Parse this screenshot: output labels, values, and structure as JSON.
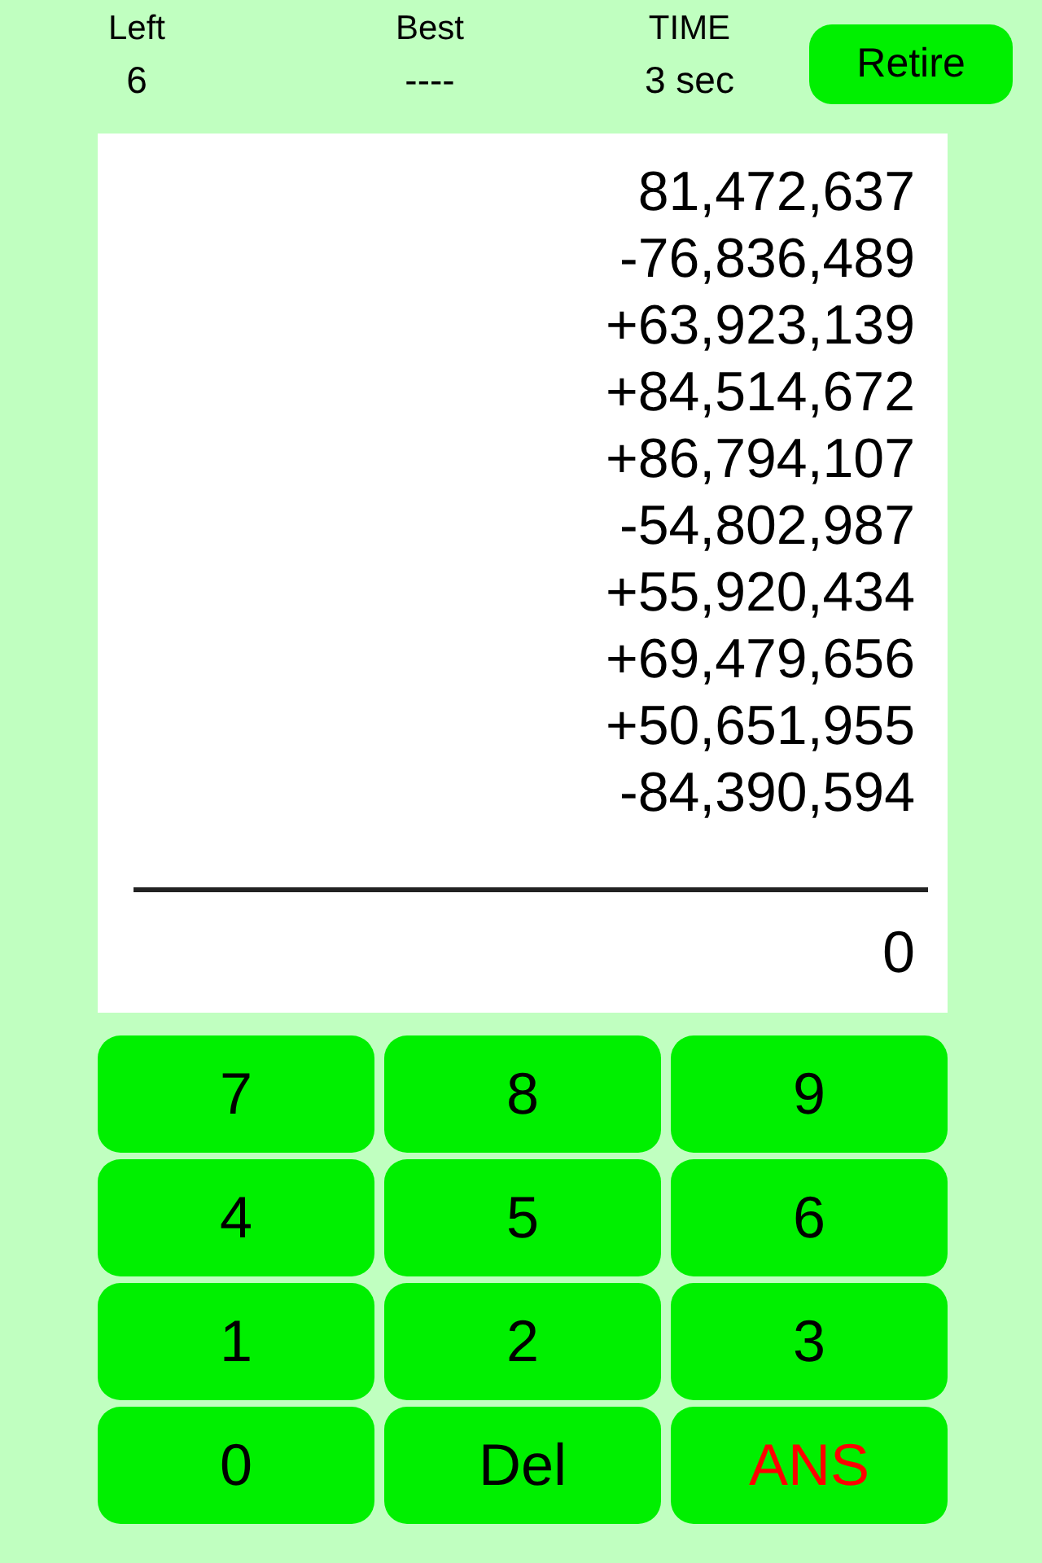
{
  "stats": [
    {
      "label": "Left",
      "value": "6"
    },
    {
      "label": "Best",
      "value": "----"
    },
    {
      "label": "TIME",
      "value": "3 sec"
    }
  ],
  "retire_button": "Retire",
  "numbers": [
    "81,472,637",
    "-76,836,489",
    "+63,923,139",
    "+84,514,672",
    "+86,794,107",
    "-54,802,987",
    "+55,920,434",
    "+69,479,656",
    "+50,651,955",
    "-84,390,594"
  ],
  "answer": "0",
  "keys": [
    {
      "label": "7",
      "kind": "digit"
    },
    {
      "label": "8",
      "kind": "digit"
    },
    {
      "label": "9",
      "kind": "digit"
    },
    {
      "label": "4",
      "kind": "digit"
    },
    {
      "label": "5",
      "kind": "digit"
    },
    {
      "label": "6",
      "kind": "digit"
    },
    {
      "label": "1",
      "kind": "digit"
    },
    {
      "label": "2",
      "kind": "digit"
    },
    {
      "label": "3",
      "kind": "digit"
    },
    {
      "label": "0",
      "kind": "digit"
    },
    {
      "label": "Del",
      "kind": "delete"
    },
    {
      "label": "ANS",
      "kind": "answer"
    }
  ]
}
